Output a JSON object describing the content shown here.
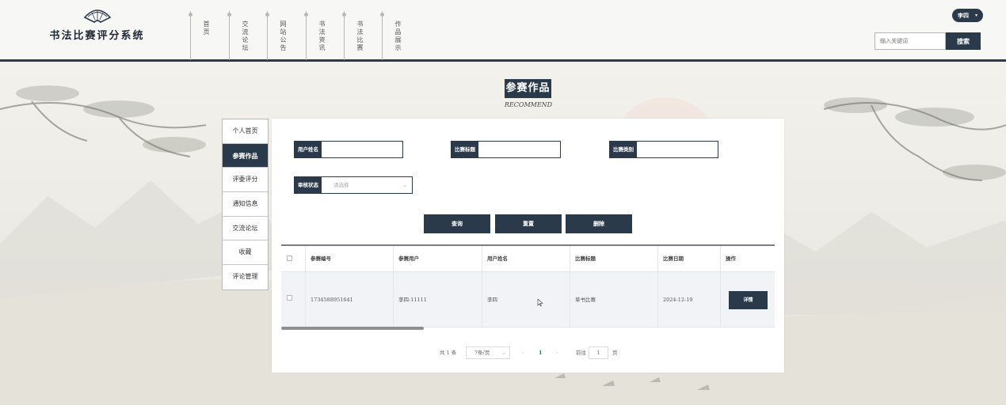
{
  "header": {
    "site_title": "书法比赛评分系统",
    "nav": [
      "首页",
      "交流论坛",
      "网站公告",
      "书法资讯",
      "书法比赛",
      "作品展示"
    ],
    "user": {
      "name": "李四"
    },
    "search": {
      "placeholder": "输入关键词",
      "button": "搜索"
    }
  },
  "page": {
    "title": "参赛作品",
    "subtitle": "RECOMMEND"
  },
  "side_menu": {
    "items": [
      "个人首页",
      "参赛作品",
      "评委评分",
      "通知信息",
      "交流论坛",
      "收藏",
      "评论管理"
    ],
    "active_index": 1
  },
  "filters": {
    "user_name": {
      "label": "用户姓名",
      "value": ""
    },
    "match_title": {
      "label": "比赛标题",
      "value": ""
    },
    "match_category": {
      "label": "比赛类别",
      "value": ""
    },
    "review_status": {
      "label": "审核状态",
      "placeholder": "请选择"
    }
  },
  "actions": {
    "query": "查询",
    "reset": "重置",
    "delete": "删除"
  },
  "table": {
    "columns": [
      "参赛编号",
      "参赛用户",
      "用户姓名",
      "比赛标题",
      "比赛日期",
      "操作"
    ],
    "rows": [
      {
        "id": "1734588951641",
        "user": "李四-11111",
        "name": "李四",
        "title": "草书比赛",
        "date": "2024-12-19",
        "action": "详情"
      }
    ]
  },
  "pagination": {
    "total": "共 1 条",
    "page_size": "7条/页",
    "current_page": "1",
    "goto_label": "前往",
    "goto_value": "1",
    "page_suffix": "页"
  },
  "colors": {
    "primary": "#2b3a4a",
    "panel": "#ffffff",
    "page_bg": "#ecebe6"
  }
}
